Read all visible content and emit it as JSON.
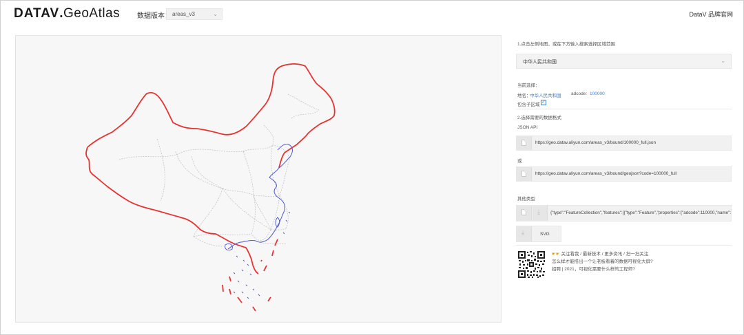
{
  "header": {
    "logo_brand": "DATAV",
    "logo_dot": ".",
    "logo_product": "GeoAtlas",
    "version_label": "数据版本：",
    "version_value": "areas_v3",
    "brand_link": "DataV 品牌官网"
  },
  "icons": {
    "dropdown": "chevron-down-icon",
    "copy": "document-copy-icon",
    "download": "download-icon",
    "checkbox": "checkmark-icon",
    "qr": "qr-code-icon",
    "emoji": "hand-pointing-icon"
  },
  "colors": {
    "border_red": "#e8322e",
    "coast_blue": "#4a55d8",
    "link_blue": "#3a7bd5",
    "province_gray": "#bdbdbd"
  },
  "side": {
    "step1": "1.点击左侧地图，或在下方输入搜索选择区域范围",
    "region_value": "中华人民共和国",
    "current_label": "当前选择：",
    "name_label": "地名：",
    "name_value": "中华人民共和国",
    "adcode_label": "adcode:",
    "adcode_value": "100000",
    "include_children_label": "包含子区域",
    "include_children": true,
    "step2": "2.选择需要的数据格式",
    "json_api_label": "JSON API",
    "url_full": "https://geo.datav.aliyun.com/areas_v3/bound/100000_full.json",
    "or_label": "或",
    "url_geojson": "https://geo.datav.aliyun.com/areas_v3/bound/geojson?code=100000_full",
    "other_types_label": "其他类型",
    "json_preview": "{\"type\":\"FeatureCollection\",\"features\":[{\"type\":\"Feature\",\"properties\":{\"adcode\":110000,\"name\":\"",
    "svg_label": "SVG",
    "promo_line1": "关注看我 / 最新技术 / 更多资讯 / 扫一扫关注",
    "promo_line2": "怎么样才能搭出一个让老板看着的数据可视化大屏?",
    "promo_line3": "招聘 | 2021，可视化需要什么样的工程师?"
  }
}
